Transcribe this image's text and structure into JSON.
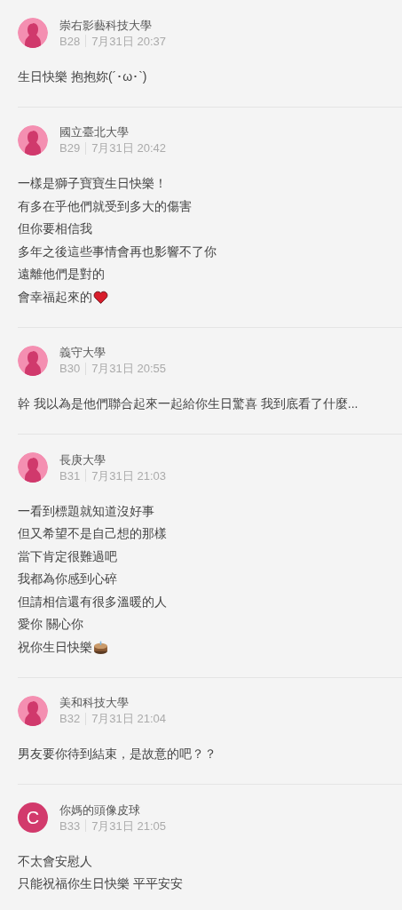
{
  "comments": [
    {
      "avatar": {
        "kind": "silhouette"
      },
      "author": "崇右影藝科技大學",
      "floor": "B28",
      "time": "7月31日 20:37",
      "lines": [
        {
          "text": "生日快樂 抱抱妳(´･ω･`)"
        }
      ]
    },
    {
      "avatar": {
        "kind": "silhouette"
      },
      "author": "國立臺北大學",
      "floor": "B29",
      "time": "7月31日 20:42",
      "lines": [
        {
          "text": "一樣是獅子寶寶生日快樂！"
        },
        {
          "text": "有多在乎他們就受到多大的傷害"
        },
        {
          "text": "但你要相信我"
        },
        {
          "text": "多年之後這些事情會再也影響不了你"
        },
        {
          "text": "遠離他們是對的"
        },
        {
          "text": "會幸福起來的",
          "kind": "heart"
        }
      ]
    },
    {
      "avatar": {
        "kind": "silhouette"
      },
      "author": "義守大學",
      "floor": "B30",
      "time": "7月31日 20:55",
      "lines": [
        {
          "text": "幹 我以為是他們聯合起來一起給你生日驚喜 我到底看了什麼..."
        }
      ]
    },
    {
      "avatar": {
        "kind": "silhouette"
      },
      "author": "長庚大學",
      "floor": "B31",
      "time": "7月31日 21:03",
      "lines": [
        {
          "text": "一看到標題就知道沒好事"
        },
        {
          "text": "但又希望不是自己想的那樣"
        },
        {
          "text": "當下肯定很難過吧"
        },
        {
          "text": "我都為你感到心碎"
        },
        {
          "text": "但請相信還有很多溫暖的人"
        },
        {
          "text": "愛你 關心你"
        },
        {
          "text": "祝你生日快樂",
          "kind": "cake"
        }
      ]
    },
    {
      "avatar": {
        "kind": "silhouette"
      },
      "author": "美和科技大學",
      "floor": "B32",
      "time": "7月31日 21:04",
      "lines": [
        {
          "text": "男友要你待到結束，是故意的吧？？"
        }
      ]
    },
    {
      "avatar": {
        "kind": "letter",
        "letter": "C"
      },
      "author": "你媽的頭像皮球",
      "floor": "B33",
      "time": "7月31日 21:05",
      "lines": [
        {
          "text": "不太會安慰人"
        },
        {
          "text": "只能祝福你生日快樂 平平安安"
        }
      ]
    }
  ]
}
